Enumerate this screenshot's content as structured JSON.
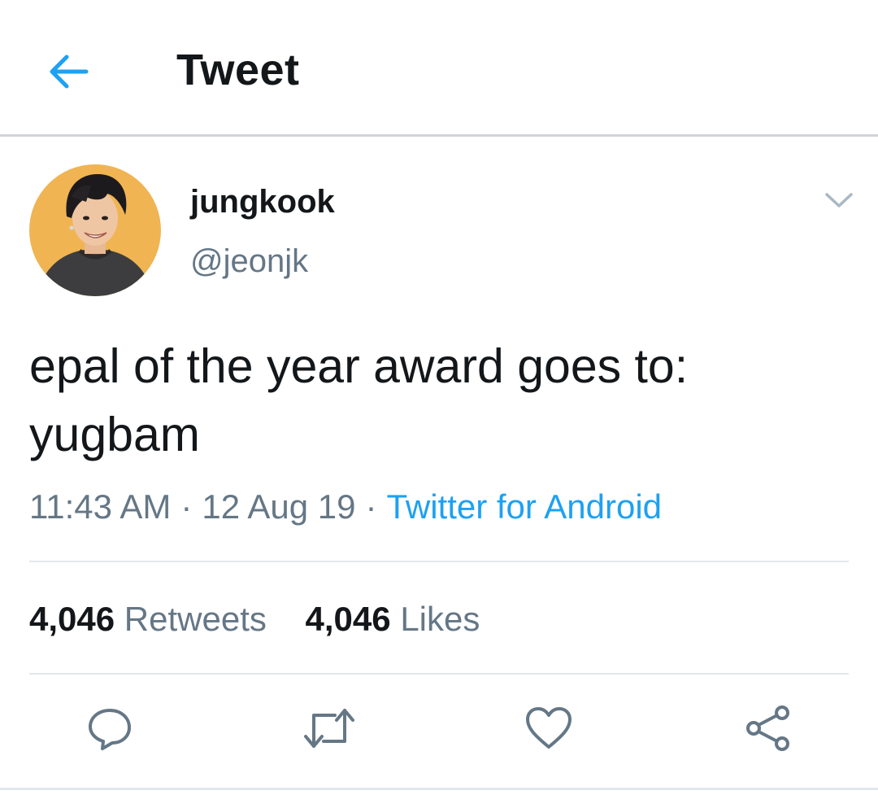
{
  "header": {
    "title": "Tweet",
    "back_icon": "arrow-left-icon",
    "accent_color": "#1da1f2"
  },
  "author": {
    "display_name": "jungkook",
    "handle": "@jeonjk",
    "avatar_bg": "#f0b452"
  },
  "tweet": {
    "text_line1": "epal of the year award goes to:",
    "text_line2": "yugbam",
    "time": "11:43 AM",
    "separator": "·",
    "date": "12 Aug 19",
    "source": "Twitter for Android"
  },
  "stats": {
    "retweets_count": "4,046",
    "retweets_label": "Retweets",
    "likes_count": "4,046",
    "likes_label": "Likes"
  },
  "actions": {
    "icons": [
      "reply-icon",
      "retweet-icon",
      "like-icon",
      "share-icon"
    ],
    "icon_color": "#657786"
  }
}
